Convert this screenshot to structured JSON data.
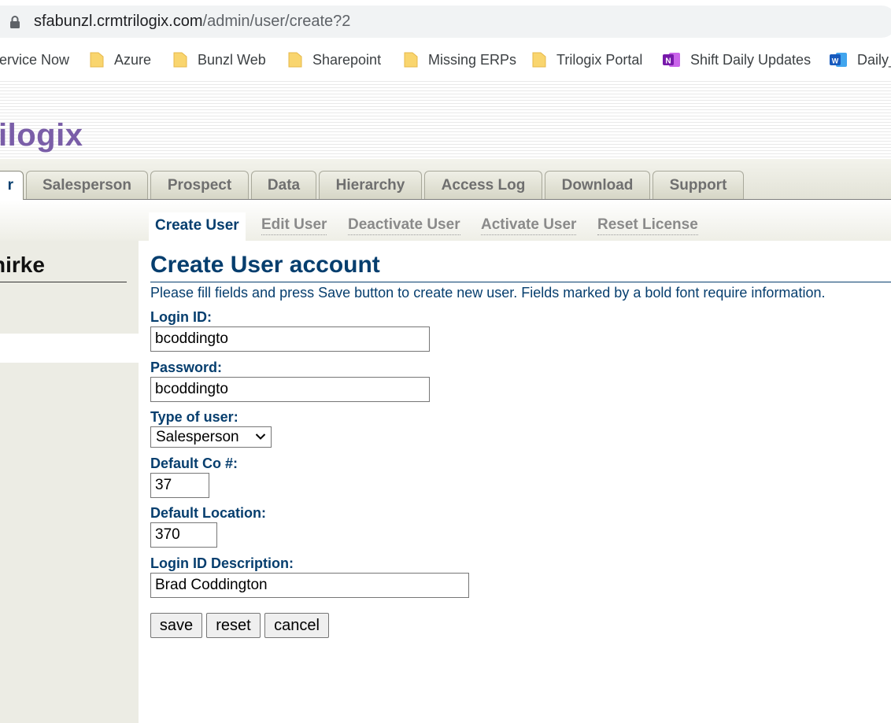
{
  "browser": {
    "url_host": "sfabunzl.crmtrilogix.com",
    "url_path": "/admin/user/create?2",
    "bookmarks": [
      {
        "label": "ervice Now",
        "icon": "none"
      },
      {
        "label": "Azure",
        "icon": "folder-icon"
      },
      {
        "label": "Bunzl Web",
        "icon": "folder-icon"
      },
      {
        "label": "Sharepoint",
        "icon": "folder-icon"
      },
      {
        "label": "Missing ERPs",
        "icon": "folder-icon"
      },
      {
        "label": "Trilogix Portal",
        "icon": "folder-icon"
      },
      {
        "label": "Shift Daily Updates",
        "icon": "onenote-icon"
      },
      {
        "label": "Daily_",
        "icon": "word-icon"
      }
    ]
  },
  "header": {
    "logo_text": "ilogix"
  },
  "tabs": [
    {
      "label": "r",
      "active": true
    },
    {
      "label": "Salesperson",
      "active": false
    },
    {
      "label": "Prospect",
      "active": false
    },
    {
      "label": "Data",
      "active": false
    },
    {
      "label": "Hierarchy",
      "active": false
    },
    {
      "label": "Access Log",
      "active": false
    },
    {
      "label": "Download",
      "active": false
    },
    {
      "label": "Support",
      "active": false
    }
  ],
  "submenu": [
    {
      "label": "Create User",
      "active": true
    },
    {
      "label": "Edit User",
      "active": false
    },
    {
      "label": "Deactivate User",
      "active": false
    },
    {
      "label": "Activate User",
      "active": false
    },
    {
      "label": "Reset License",
      "active": false
    }
  ],
  "sidebar": {
    "username": "hirke"
  },
  "form": {
    "title": "Create User account",
    "intro": "Please fill fields and press Save button to create new user. Fields marked by a bold font require information.",
    "login_id_label": "Login ID:",
    "login_id_value": "bcoddingto",
    "password_label": "Password:",
    "password_value": "bcoddingto",
    "type_label": "Type of user:",
    "type_value": "Salesperson",
    "default_co_label": "Default Co #:",
    "default_co_value": "37",
    "default_location_label": "Default Location:",
    "default_location_value": "370",
    "description_label": "Login ID Description:",
    "description_value": "Brad Coddington",
    "buttons": {
      "save": "save",
      "reset": "reset",
      "cancel": "cancel"
    }
  },
  "colors": {
    "accent": "#063e6e",
    "logo": "#7a5ea8",
    "sidebar_bg": "#ecece4"
  }
}
